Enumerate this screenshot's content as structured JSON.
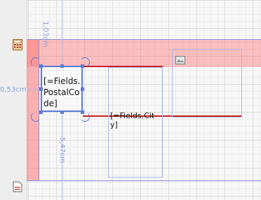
{
  "fields": {
    "postal_code_label": "[=Fields.PostalCode]",
    "city_label": "[=Fields.City]"
  },
  "dimensions": {
    "top": "1,03cm",
    "left": "0,53cm",
    "bottom": "5,47cm"
  },
  "icons": {
    "report_header": "calculator-icon",
    "report_footer": "document-icon",
    "picture": "picture-icon"
  },
  "colors": {
    "band": "#ff7878",
    "selection": "#5b7cd8",
    "guide": "#8a8ad8",
    "baseline": "#cc2020"
  }
}
